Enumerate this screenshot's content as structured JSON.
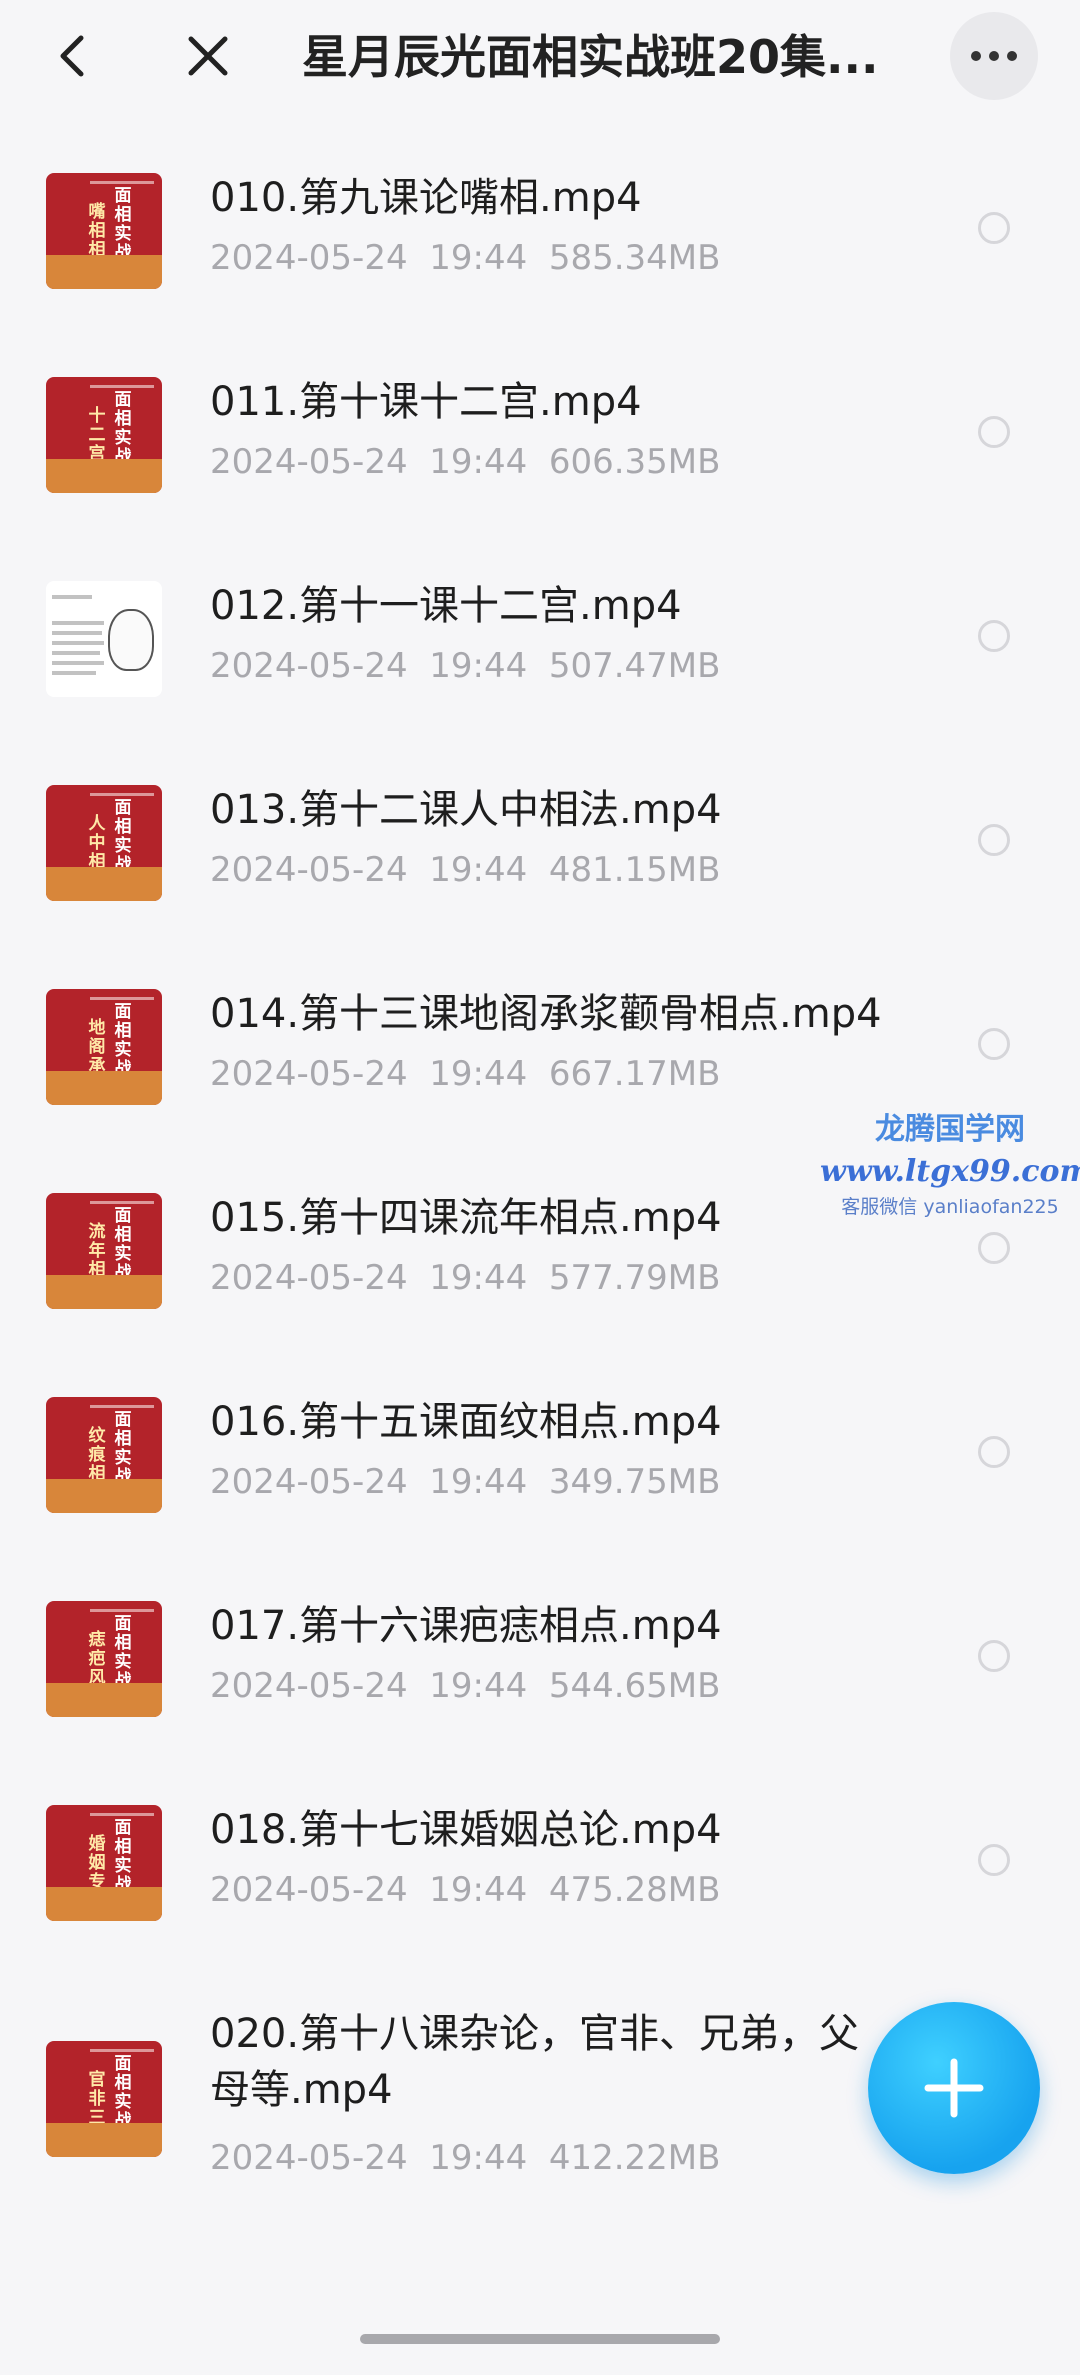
{
  "header": {
    "title": "星月辰光面相实战班20集...",
    "back_icon": "chevron-left-icon",
    "close_icon": "close-icon",
    "more_icon": "more-horizontal-icon"
  },
  "files": [
    {
      "name": "010.第九课论嘴相.mp4",
      "date": "2024-05-24",
      "time": "19:44",
      "size": "585.34MB",
      "thumb": "嘴相相点"
    },
    {
      "name": "011.第十课十二宫.mp4",
      "date": "2024-05-24",
      "time": "19:44",
      "size": "606.35MB",
      "thumb": "十二宫"
    },
    {
      "name": "012.第十一课十二宫.mp4",
      "date": "2024-05-24",
      "time": "19:44",
      "size": "507.47MB",
      "thumb": ""
    },
    {
      "name": "013.第十二课人中相法.mp4",
      "date": "2024-05-24",
      "time": "19:44",
      "size": "481.15MB",
      "thumb": "人中相点"
    },
    {
      "name": "014.第十三课地阁承浆颧骨相点.mp4",
      "date": "2024-05-24",
      "time": "19:44",
      "size": "667.17MB",
      "thumb": "地阁承浆"
    },
    {
      "name": "015.第十四课流年相点.mp4",
      "date": "2024-05-24",
      "time": "19:44",
      "size": "577.79MB",
      "thumb": "流年相点"
    },
    {
      "name": "016.第十五课面纹相点.mp4",
      "date": "2024-05-24",
      "time": "19:44",
      "size": "349.75MB",
      "thumb": "纹痕相点"
    },
    {
      "name": "017.第十六课疤痣相点.mp4",
      "date": "2024-05-24",
      "time": "19:44",
      "size": "544.65MB",
      "thumb": "痣疤风水"
    },
    {
      "name": "018.第十七课婚姻总论.mp4",
      "date": "2024-05-24",
      "time": "19:44",
      "size": "475.28MB",
      "thumb": "婚姻专论"
    },
    {
      "name": "020.第十八课杂论，官非、兄弟，父母等.mp4",
      "date": "2024-05-24",
      "time": "19:44",
      "size": "412.22MB",
      "thumb": "官非三关论"
    }
  ],
  "thumb_common": "面相实战",
  "watermark": {
    "title": "龙腾国学网",
    "url": "www.ltgx99.com",
    "contact": "客服微信 yanliaofan225"
  },
  "fab": {
    "icon": "plus-icon"
  },
  "colors": {
    "fab": "#17a3ef",
    "thumb_red": "#b3232a",
    "meta_gray": "#a8a8ad"
  }
}
